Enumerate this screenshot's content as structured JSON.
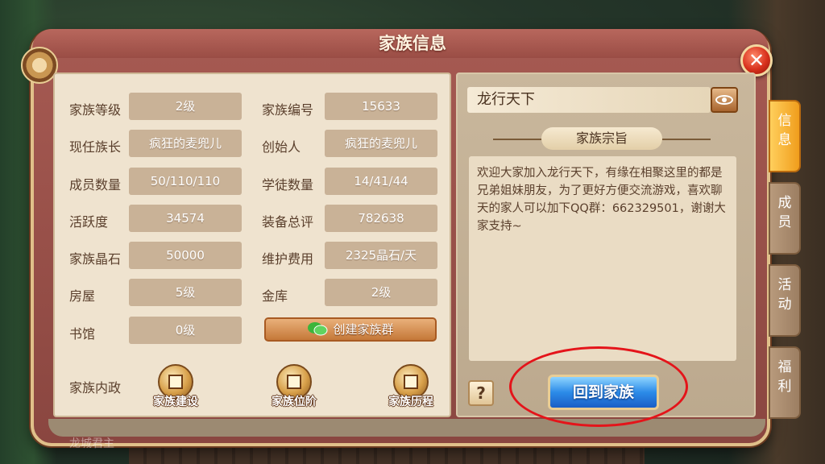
{
  "window": {
    "title": "家族信息",
    "close_symbol": "✕"
  },
  "info": [
    {
      "label": "家族等级",
      "value": "2级"
    },
    {
      "label": "家族编号",
      "value": "15633"
    },
    {
      "label": "现任族长",
      "value": "疯狂的麦兜儿"
    },
    {
      "label": "创始人",
      "value": "疯狂的麦兜儿"
    },
    {
      "label": "成员数量",
      "value": "50/110/110"
    },
    {
      "label": "学徒数量",
      "value": "14/41/44"
    },
    {
      "label": "活跃度",
      "value": "34574"
    },
    {
      "label": "装备总评",
      "value": "782638"
    },
    {
      "label": "家族晶石",
      "value": "50000"
    },
    {
      "label": "维护费用",
      "value": "2325晶石/天"
    },
    {
      "label": "房屋",
      "value": "5级"
    },
    {
      "label": "金库",
      "value": "2级"
    },
    {
      "label": "书馆",
      "value": "0级"
    }
  ],
  "actions": {
    "create_group": "创建家族群",
    "internal_label": "家族内政",
    "buttons": [
      "家族建设",
      "家族位阶",
      "家族历程"
    ]
  },
  "right": {
    "family_name": "龙行天下",
    "purpose_title": "家族宗旨",
    "purpose_text": "欢迎大家加入龙行天下，有缘在相聚这里的都是兄弟姐妹朋友，为了更好方便交流游戏，喜欢聊天的家人可以加下QQ群：662329501，谢谢大家支持~",
    "help_symbol": "?",
    "return_button": "回到家族"
  },
  "tabs": [
    "信息",
    "成员",
    "活动",
    "福利"
  ],
  "watermark": "龙城君主",
  "colors": {
    "accent_tab": "#f5a623",
    "return_button": "#2c8be8",
    "highlight_ring": "#e4141a"
  }
}
